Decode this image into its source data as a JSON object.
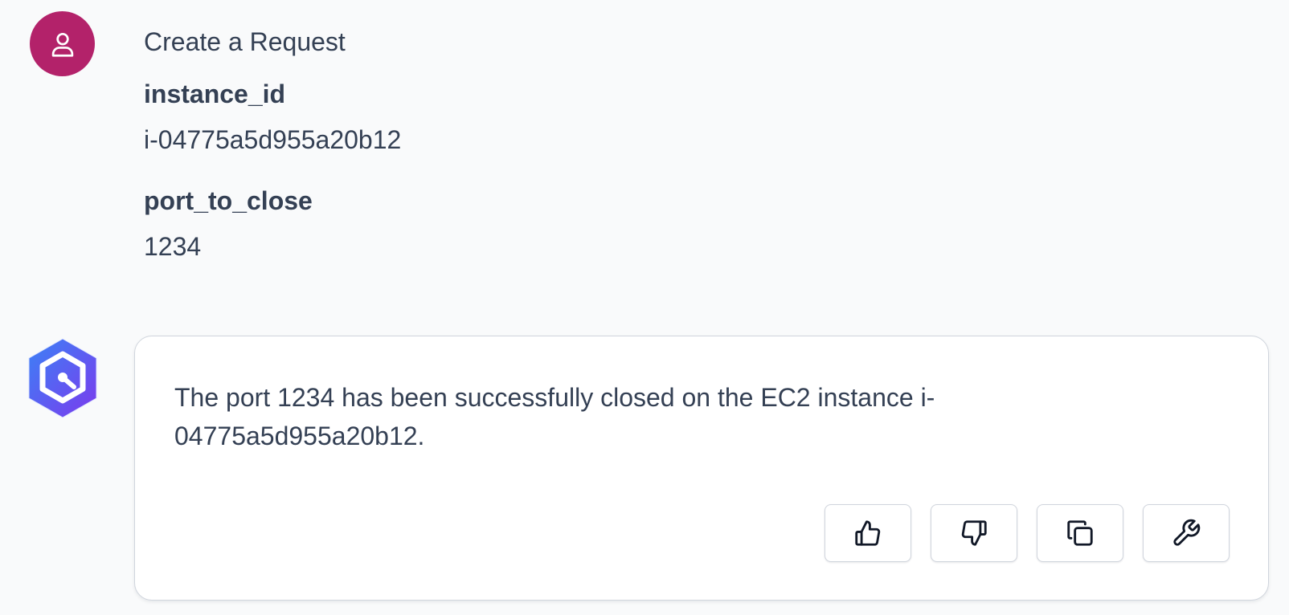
{
  "user_message": {
    "avatar_icon": "user-icon",
    "avatar_color": "#b3226a",
    "title": "Create a Request",
    "fields": [
      {
        "key": "instance_id",
        "value": "i-04775a5d955a20b12"
      },
      {
        "key": "port_to_close",
        "value": "1234"
      }
    ]
  },
  "assistant_message": {
    "avatar_icon": "hexagon-logo-icon",
    "avatar_colors": [
      "#3b82f6",
      "#7c3aed"
    ],
    "text": "The port 1234 has been successfully closed on the EC2 instance i-04775a5d955a20b12.",
    "actions": [
      {
        "name": "thumbs-up",
        "icon": "thumbs-up-icon"
      },
      {
        "name": "thumbs-down",
        "icon": "thumbs-down-icon"
      },
      {
        "name": "copy",
        "icon": "copy-icon"
      },
      {
        "name": "tool",
        "icon": "wrench-icon"
      }
    ]
  }
}
